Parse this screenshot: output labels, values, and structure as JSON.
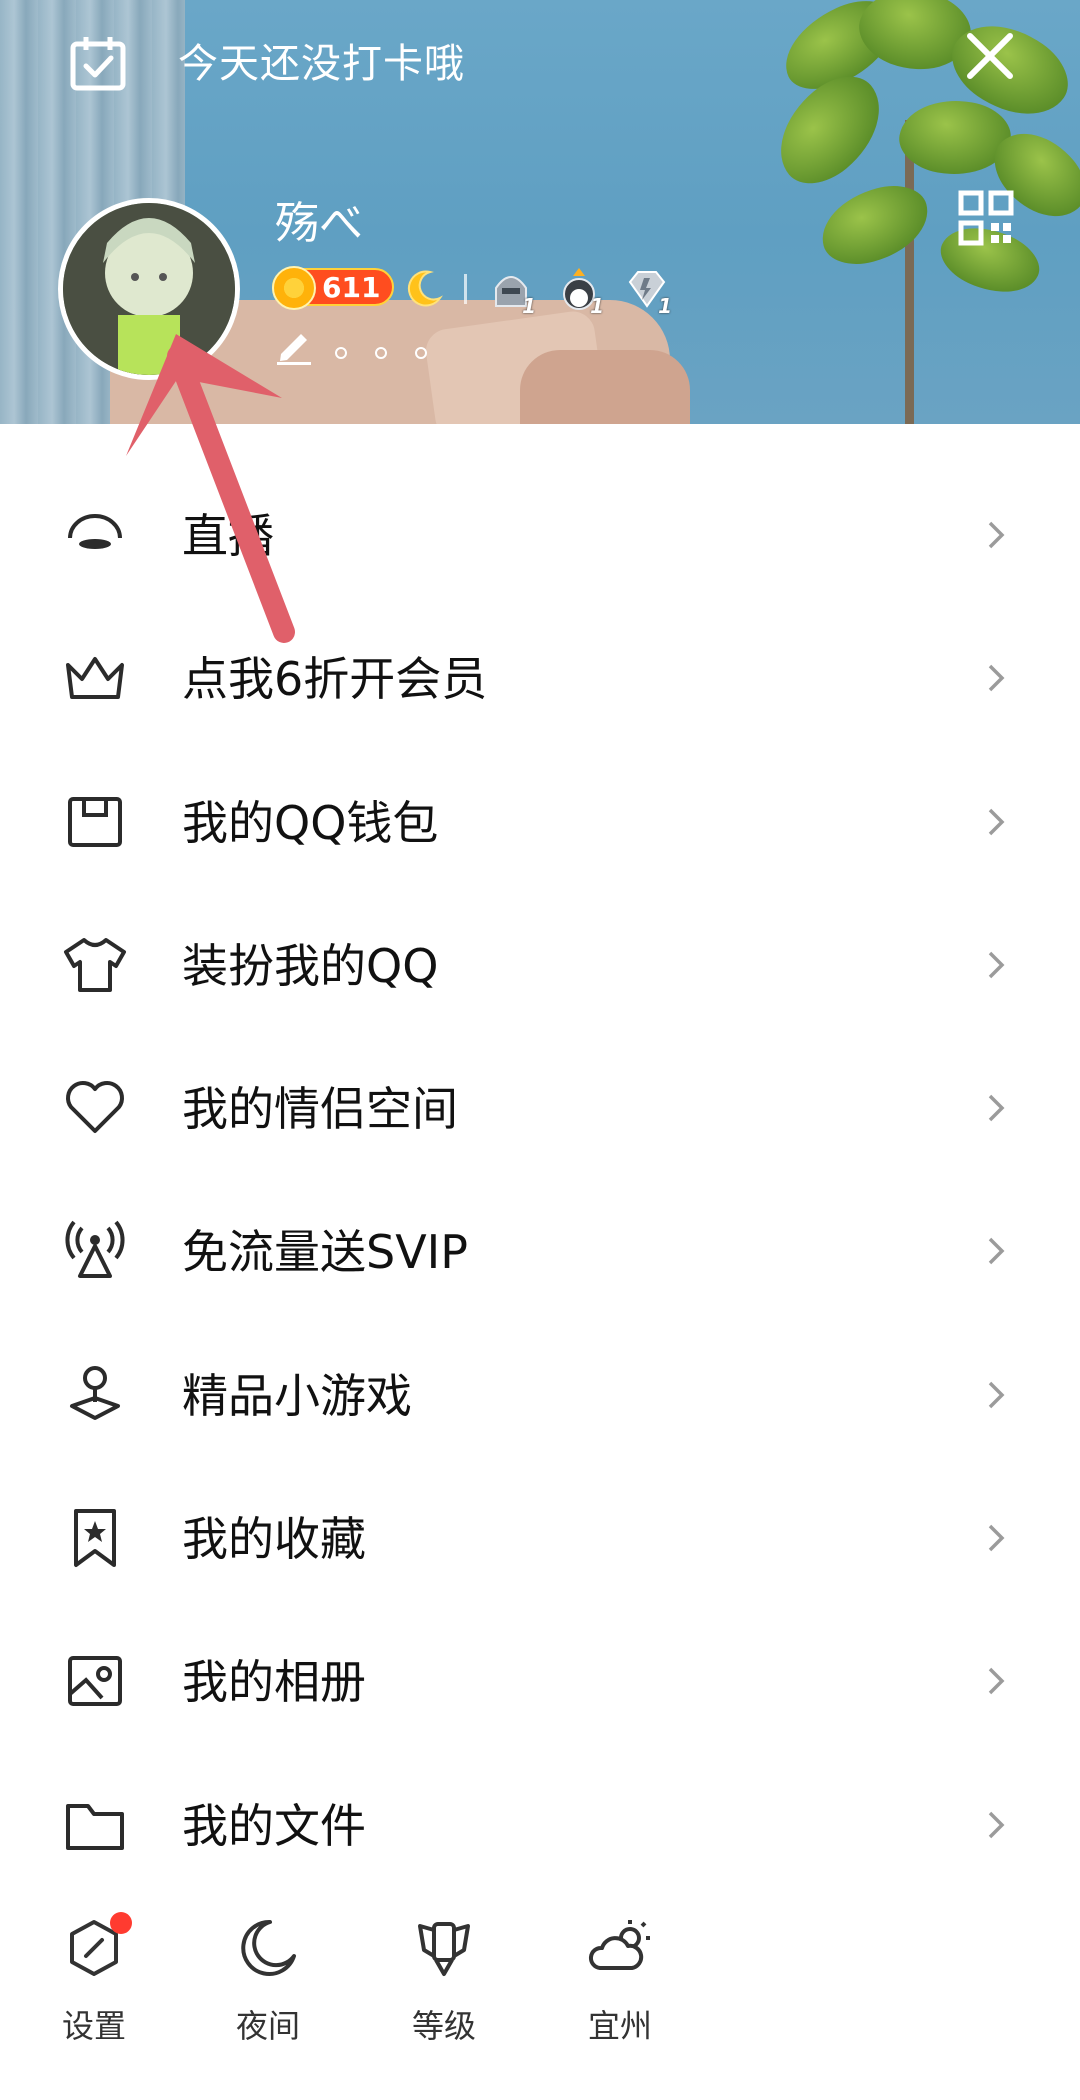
{
  "header": {
    "checkin_text": "今天还没打卡哦",
    "username": "殇べ",
    "sun_level": "611",
    "medal_counts": [
      "1",
      "1",
      "1"
    ]
  },
  "menu": {
    "items": [
      {
        "label": "直播",
        "icon": "live-icon"
      },
      {
        "label": "点我6折开会员",
        "icon": "crown-icon"
      },
      {
        "label": "我的QQ钱包",
        "icon": "wallet-icon"
      },
      {
        "label": "装扮我的QQ",
        "icon": "tshirt-icon"
      },
      {
        "label": "我的情侣空间",
        "icon": "heart-icon"
      },
      {
        "label": "免流量送SVIP",
        "icon": "signal-tower-icon"
      },
      {
        "label": "精品小游戏",
        "icon": "joystick-icon"
      },
      {
        "label": "我的收藏",
        "icon": "bookmark-star-icon"
      },
      {
        "label": "我的相册",
        "icon": "photo-album-icon"
      },
      {
        "label": "我的文件",
        "icon": "folder-icon"
      }
    ]
  },
  "bottom_bar": {
    "items": [
      {
        "label": "设置",
        "icon": "settings-icon"
      },
      {
        "label": "夜间",
        "icon": "moon-icon"
      },
      {
        "label": "等级",
        "icon": "level-icon"
      },
      {
        "label": "宜州",
        "icon": "weather-icon"
      }
    ]
  },
  "colors": {
    "accent_red": "#ff3b30",
    "annotation_arrow": "#e0606a",
    "icon_dark": "#2b2b2b"
  }
}
